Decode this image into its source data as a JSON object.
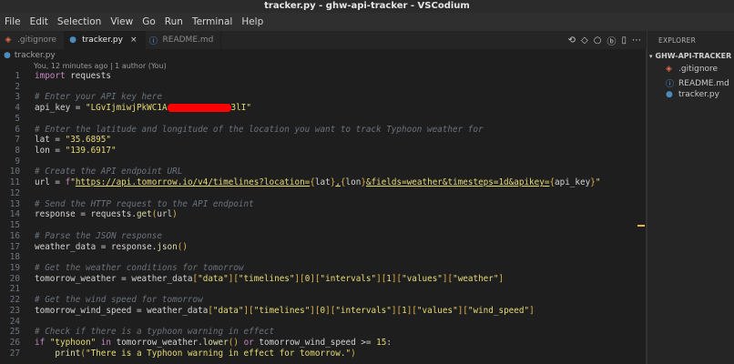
{
  "window": {
    "title": "tracker.py - ghw-api-tracker - VSCodium"
  },
  "menu": [
    "File",
    "Edit",
    "Selection",
    "View",
    "Go",
    "Run",
    "Terminal",
    "Help"
  ],
  "tabs": [
    {
      "label": ".gitignore",
      "icon": "git-icon",
      "active": false
    },
    {
      "label": "tracker.py",
      "icon": "python-icon",
      "active": true,
      "close": "×"
    },
    {
      "label": "README.md",
      "icon": "info-icon",
      "active": false
    }
  ],
  "editor_actions": [
    "⟲",
    "◇",
    "○",
    "ⓑ",
    "▯",
    "⋯"
  ],
  "breadcrumb": {
    "file": "tracker.py"
  },
  "blame": "You, 12 minutes ago | 1 author (You)",
  "code": {
    "lines": [
      {
        "n": "1",
        "html": "<span class=\"kw\">import</span> requests"
      },
      {
        "n": "2",
        "html": ""
      },
      {
        "n": "3",
        "html": "<span class=\"cm\"># Enter your API key here</span>"
      },
      {
        "n": "4",
        "html": "api_key = <span class=\"str\">\"LGvIjmiwjPkWC1A</span><span class=\"redact\"></span><span class=\"str\">3lI\"</span>"
      },
      {
        "n": "5",
        "html": ""
      },
      {
        "n": "6",
        "html": "<span class=\"cm\"># Enter the latitude and longitude of the location you want to track Typhoon weather for</span>"
      },
      {
        "n": "7",
        "html": "lat = <span class=\"str\">\"35.6895\"</span>"
      },
      {
        "n": "8",
        "html": "lon = <span class=\"str\">\"139.6917\"</span>"
      },
      {
        "n": "9",
        "html": ""
      },
      {
        "n": "10",
        "html": "<span class=\"cm\"># Create the API endpoint URL</span>"
      },
      {
        "n": "11",
        "html": "url = <span class=\"kw\">f</span><span class=\"str\">\"</span><span class=\"url\">https://api.tomorrow.io/v4/timelines?location=</span><span class=\"brk\">{</span>lat<span class=\"brk\">}</span><span class=\"url\">,</span><span class=\"brk\">{</span>lon<span class=\"brk\">}</span><span class=\"url\">&amp;fields=weather&amp;timesteps=1d&amp;apikey=</span><span class=\"brk\">{</span>api_key<span class=\"brk\">}</span><span class=\"str\">\"</span>"
      },
      {
        "n": "12",
        "html": ""
      },
      {
        "n": "13",
        "html": "<span class=\"cm\"># Send the HTTP request to the API endpoint</span>"
      },
      {
        "n": "14",
        "html": "response = requests.<span class=\"fn\">get</span><span class=\"brk\">(</span>url<span class=\"brk\">)</span>"
      },
      {
        "n": "15",
        "html": ""
      },
      {
        "n": "16",
        "html": "<span class=\"cm\"># Parse the JSON response</span>"
      },
      {
        "n": "17",
        "html": "weather_data = response.<span class=\"fn\">json</span><span class=\"brk\">()</span>"
      },
      {
        "n": "18",
        "html": ""
      },
      {
        "n": "19",
        "html": "<span class=\"cm\"># Get the weather conditions for tomorrow</span>"
      },
      {
        "n": "20",
        "html": "tomorrow_weather = weather_data<span class=\"brk\">[</span><span class=\"str\">\"data\"</span><span class=\"brk\">][</span><span class=\"str\">\"timelines\"</span><span class=\"brk\">][</span><span class=\"num\">0</span><span class=\"brk\">][</span><span class=\"str\">\"intervals\"</span><span class=\"brk\">][</span><span class=\"num\">1</span><span class=\"brk\">][</span><span class=\"str\">\"values\"</span><span class=\"brk\">][</span><span class=\"str\">\"weather\"</span><span class=\"brk\">]</span>"
      },
      {
        "n": "21",
        "html": ""
      },
      {
        "n": "22",
        "html": "<span class=\"cm\"># Get the wind speed for tomorrow</span>"
      },
      {
        "n": "23",
        "html": "tomorrow_wind_speed = weather_data<span class=\"brk\">[</span><span class=\"str\">\"data\"</span><span class=\"brk\">][</span><span class=\"str\">\"timelines\"</span><span class=\"brk\">][</span><span class=\"num\">0</span><span class=\"brk\">][</span><span class=\"str\">\"intervals\"</span><span class=\"brk\">][</span><span class=\"num\">1</span><span class=\"brk\">][</span><span class=\"str\">\"values\"</span><span class=\"brk\">][</span><span class=\"str\">\"wind_speed\"</span><span class=\"brk\">]</span>"
      },
      {
        "n": "24",
        "html": ""
      },
      {
        "n": "25",
        "html": "<span class=\"cm\"># Check if there is a typhoon warning in effect</span>"
      },
      {
        "n": "26",
        "html": "<span class=\"kw\">if</span> <span class=\"str\">\"typhoon\"</span> <span class=\"kw\">in</span> tomorrow_weather.<span class=\"fn\">lower</span><span class=\"brk\">()</span> <span class=\"kw\">or</span> tomorrow_wind_speed &gt;= <span class=\"num\">15</span>:"
      },
      {
        "n": "27",
        "html": "    <span class=\"fn\">print</span><span class=\"brk\">(</span><span class=\"str\">\"There is a Typhoon warning in effect for tomorrow.\"</span><span class=\"brk\">)</span>"
      }
    ]
  },
  "explorer": {
    "header": "EXPLORER",
    "root": "GHW-API-TRACKER",
    "files": [
      {
        "label": ".gitignore",
        "icon": "git-icon"
      },
      {
        "label": "README.md",
        "icon": "info-icon"
      },
      {
        "label": "tracker.py",
        "icon": "python-icon"
      }
    ]
  },
  "colors": {
    "accent": "#e0b54a",
    "redaction": "#ff0000"
  }
}
